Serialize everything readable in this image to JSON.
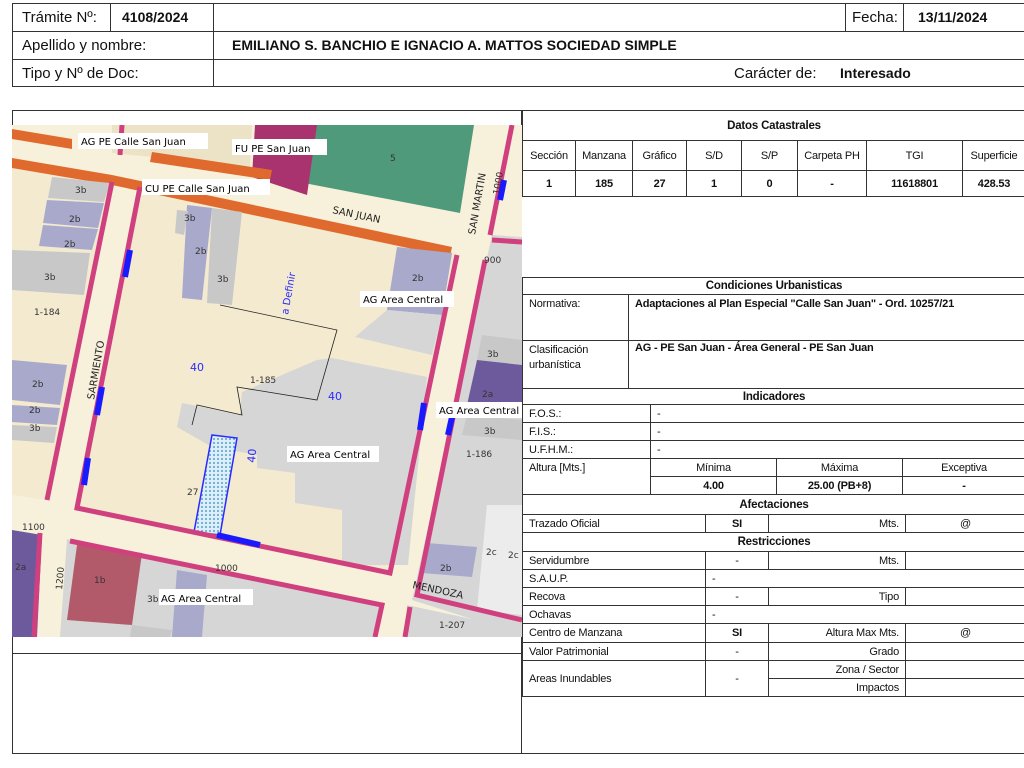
{
  "header": {
    "tramite_label": "Trámite Nº:",
    "tramite_value": "4108/2024",
    "fecha_label": "Fecha:",
    "fecha_value": "13/11/2024",
    "apellido_label": "Apellido y nombre:",
    "apellido_value": "EMILIANO S. BANCHIO E IGNACIO A. MATTOS SOCIEDAD SIMPLE",
    "tipo_doc_label": "Tipo y Nº de Doc:",
    "caracter_label": "Carácter de:",
    "caracter_value": "Interesado"
  },
  "catastrales": {
    "title": "Datos Catastrales",
    "columns": [
      "Sección",
      "Manzana",
      "Gráfico",
      "S/D",
      "S/P",
      "Carpeta PH",
      "TGI",
      "Superficie"
    ],
    "values": [
      "1",
      "185",
      "27",
      "1",
      "0",
      "-",
      "11618801",
      "428.53"
    ]
  },
  "condiciones": {
    "title": "Condiciones Urbanisticas",
    "normativa_label": "Normativa:",
    "normativa_value": "Adaptaciones al Plan Especial \"Calle San Juan\" - Ord. 10257/21",
    "clasificacion_label": "Clasificación urbanística",
    "clasificacion_value": "AG - PE San Juan - Área General - PE San Juan"
  },
  "indicadores": {
    "title": "Indicadores",
    "fos_label": "F.O.S.:",
    "fos_value": "-",
    "fis_label": "F.I.S.:",
    "fis_value": "-",
    "ufhm_label": "U.F.H.M.:",
    "ufhm_value": "-",
    "altura_label": "Altura [Mts.]",
    "minima_label": "Mínima",
    "minima_value": "4.00",
    "maxima_label": "Máxima",
    "maxima_value": "25.00 (PB+8)",
    "exceptiva_label": "Exceptiva",
    "exceptiva_value": "-"
  },
  "afectaciones": {
    "title": "Afectaciones",
    "trazado_label": "Trazado Oficial",
    "trazado_value": "SI",
    "trazado_mts_label": "Mts.",
    "trazado_mts_value": "@"
  },
  "restricciones": {
    "title": "Restricciones",
    "servidumbre_label": "Servidumbre",
    "servidumbre_value": "-",
    "servidumbre_mts_label": "Mts.",
    "saup_label": "S.A.U.P.",
    "saup_value": "-",
    "recova_label": "Recova",
    "recova_value": "-",
    "recova_tipo_label": "Tipo",
    "ochavas_label": "Ochavas",
    "ochavas_value": "-",
    "centro_label": "Centro de Manzana",
    "centro_value": "SI",
    "centro_altura_label": "Altura Max Mts.",
    "centro_altura_value": "@",
    "valor_label": "Valor Patrimonial",
    "valor_value": "-",
    "grado_label": "Grado",
    "areas_label": "Areas Inundables",
    "areas_value": "-",
    "zona_label": "Zona / Sector",
    "impactos_label": "Impactos"
  },
  "map": {
    "labels": {
      "ag_pe_calle_san_juan": "AG PE Calle San Juan",
      "fu_pe_san_juan": "FU PE San Juan",
      "cu_pe_calle_san_juan": "CU PE Calle San Juan",
      "ag_area_central_1": "AG Area Central",
      "ag_area_central_2": "AG Area Central",
      "ag_area_central_3": "AG Area Central",
      "ag_area_central_4": "AG Area Central",
      "a_definir": "a Definir"
    },
    "streets": {
      "san_juan": "SAN JUAN",
      "san_martin": "SAN MARTIN",
      "sarmiento": "SARMIENTO",
      "mendoza": "MENDOZA"
    },
    "block_ids": [
      "1-184",
      "1-185",
      "1-186",
      "1-207"
    ],
    "numbers": [
      "1000",
      "900",
      "1100",
      "1200",
      "1000",
      "40",
      "40",
      "40"
    ],
    "zones": [
      "5",
      "3b",
      "2b",
      "2b",
      "3b",
      "2b",
      "3b",
      "3b",
      "2b",
      "2b",
      "2b",
      "3b",
      "3b",
      "2a",
      "3b",
      "2c",
      "2c",
      "2b",
      "2a",
      "1b",
      "3b"
    ],
    "parcel": "27"
  }
}
